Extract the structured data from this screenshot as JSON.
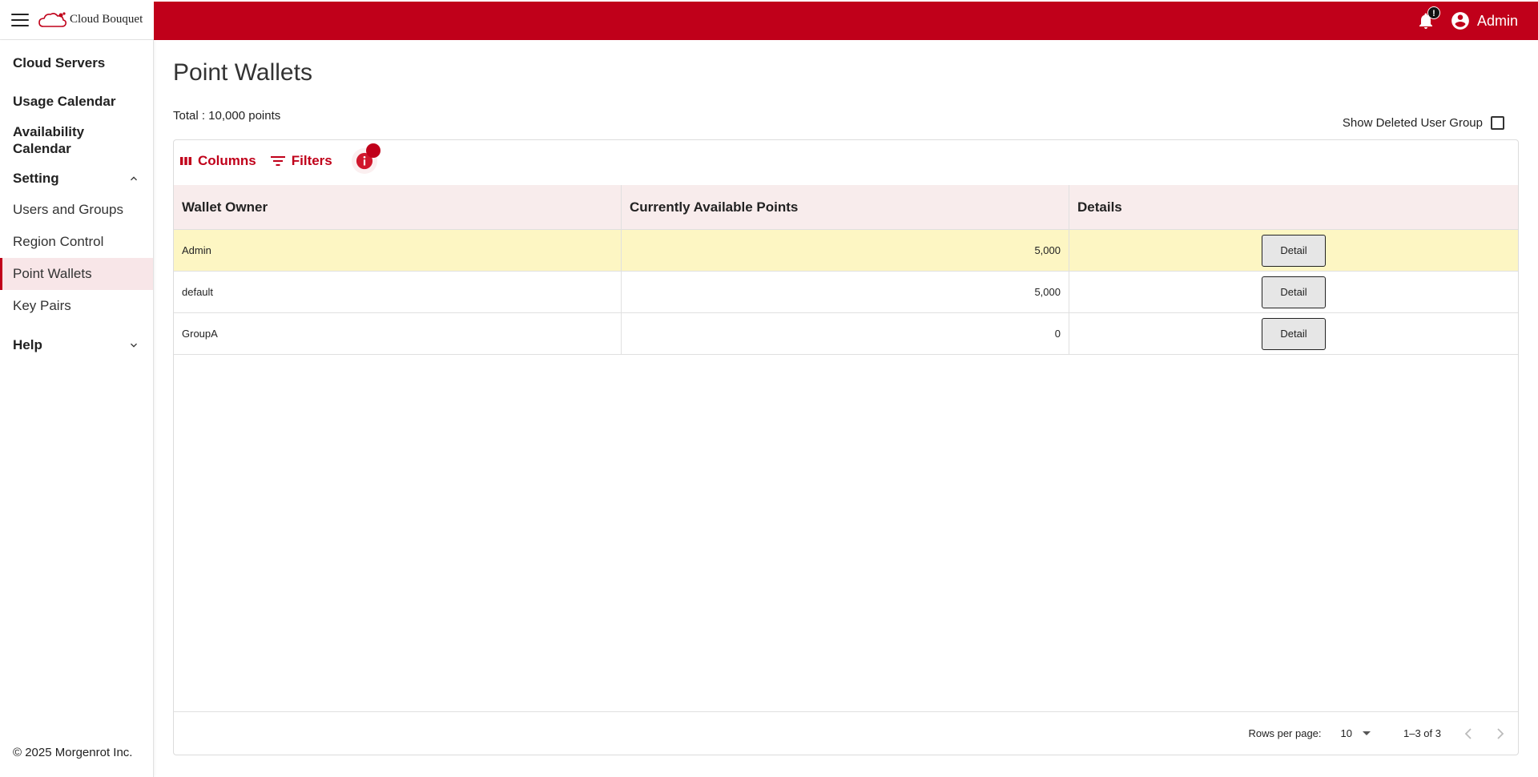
{
  "header": {
    "logo_text": "Cloud Bouquet",
    "notification_badge": "!",
    "user_name": "Admin",
    "accent_color": "#c0001a"
  },
  "sidebar": {
    "items": [
      {
        "label": "Cloud Servers"
      },
      {
        "label": "Usage Calendar"
      },
      {
        "label": "Availability Calendar"
      },
      {
        "label": "Setting"
      },
      {
        "label": "Users and Groups"
      },
      {
        "label": "Region Control"
      },
      {
        "label": "Point Wallets"
      },
      {
        "label": "Key Pairs"
      },
      {
        "label": "Help"
      }
    ],
    "footer": "© 2025 Morgenrot Inc."
  },
  "main": {
    "title": "Point Wallets",
    "total": "Total : 10,000 points",
    "show_deleted_label": "Show Deleted User Group",
    "toolbar": {
      "columns": "Columns",
      "filters": "Filters"
    },
    "columns": [
      "Wallet Owner",
      "Currently Available Points",
      "Details"
    ],
    "rows": [
      {
        "owner": "Admin",
        "points": "5,000",
        "action": "Detail"
      },
      {
        "owner": "default",
        "points": "5,000",
        "action": "Detail"
      },
      {
        "owner": "GroupA",
        "points": "0",
        "action": "Detail"
      }
    ],
    "pagination": {
      "rows_per_page_label": "Rows per page:",
      "rows_per_page": "10",
      "range": "1–3 of 3"
    }
  }
}
